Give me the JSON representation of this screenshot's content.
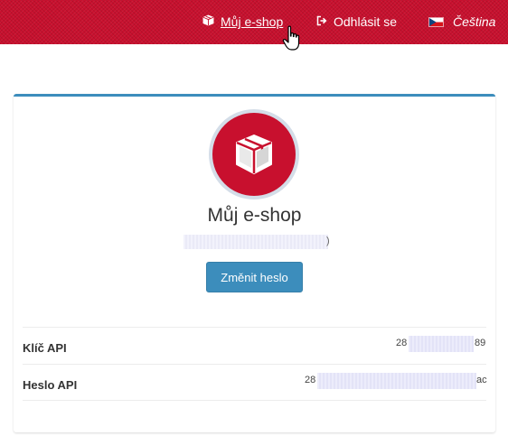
{
  "topbar": {
    "shop_link": "Můj e-shop",
    "logout_link": "Odhlásit se",
    "language": "Čeština"
  },
  "profile": {
    "shop_name": "Můj e-shop",
    "email_visible_end": ")",
    "change_password_button": "Změnit heslo"
  },
  "api": {
    "rows": [
      {
        "label": "Klíč API",
        "value_start": "28",
        "value_end": "89"
      },
      {
        "label": "Heslo API",
        "value_start": "28",
        "value_end": "ac"
      }
    ]
  },
  "colors": {
    "header_red": "#c8102e",
    "accent_blue": "#3c8dbc"
  },
  "icons": {
    "shop": "box-icon",
    "logout": "logout-icon",
    "language": "czech-flag-icon",
    "avatar": "package-box-icon",
    "pointer": "hand-cursor-icon"
  }
}
